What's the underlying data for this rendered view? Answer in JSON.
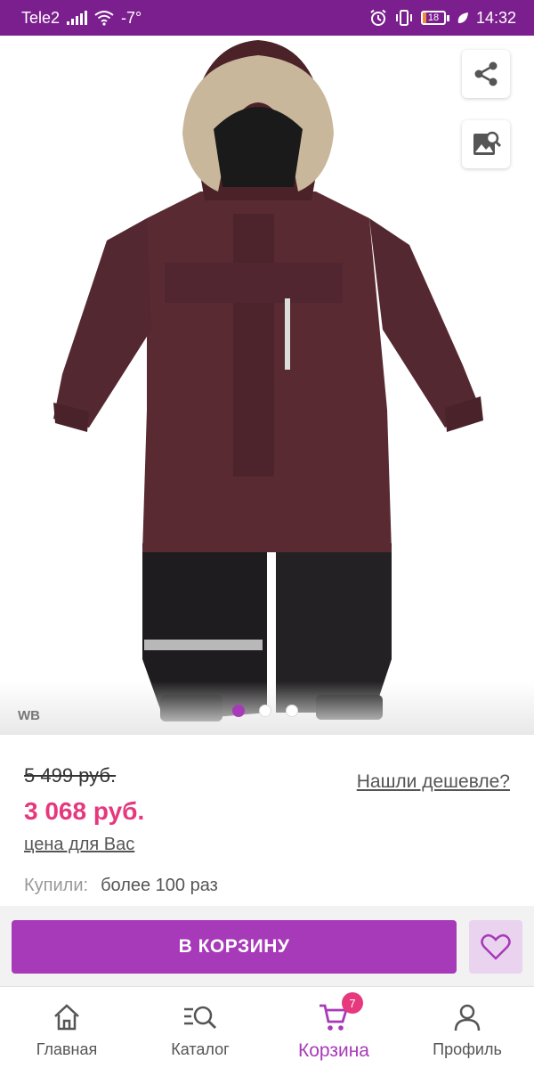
{
  "status_bar": {
    "carrier": "Tele2",
    "temperature": "-7°",
    "battery": "18",
    "battery_level": 0.18,
    "time": "14:32"
  },
  "product": {
    "brand_badge": "WB",
    "gallery_dots": 3,
    "active_dot": 0,
    "old_price": "5 499 руб.",
    "new_price": "3 068 руб.",
    "price_for_you": "цена для Вас",
    "found_cheaper": "Нашли дешевле?",
    "bought_label": "Купили:",
    "bought_value": "более 100 раз"
  },
  "actions": {
    "add_to_cart": "В КОРЗИНУ"
  },
  "nav": {
    "items": [
      {
        "label": "Главная",
        "icon": "home-icon"
      },
      {
        "label": "Каталог",
        "icon": "catalog-search-icon"
      },
      {
        "label": "Корзина",
        "icon": "cart-icon",
        "badge": "7",
        "active": true
      },
      {
        "label": "Профиль",
        "icon": "user-icon"
      }
    ]
  },
  "colors": {
    "status_bar": "#7b1f8e",
    "accent": "#a73ab8",
    "price": "#e5387d",
    "fav_bg": "#e9d3ee"
  }
}
